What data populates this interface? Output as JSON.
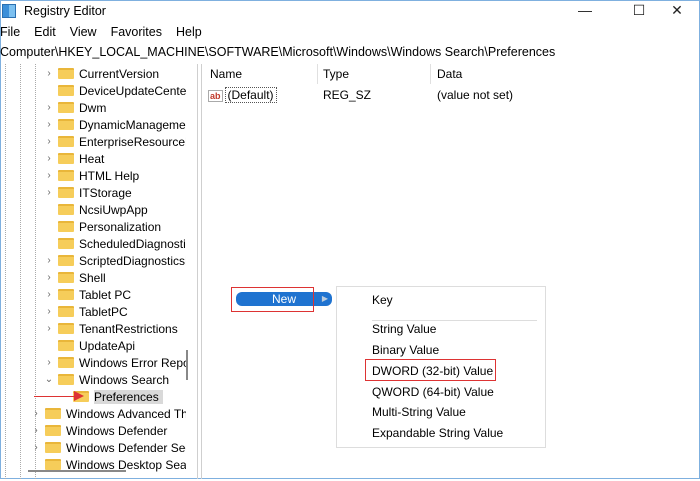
{
  "window": {
    "title": "Registry Editor",
    "minimize": "—",
    "maximize": "☐",
    "close": "✕"
  },
  "menu": [
    "File",
    "Edit",
    "View",
    "Favorites",
    "Help"
  ],
  "address": "Computer\\HKEY_LOCAL_MACHINE\\SOFTWARE\\Microsoft\\Windows\\Windows Search\\Preferences",
  "tree": [
    {
      "label": "CurrentVersion",
      "chev": ">"
    },
    {
      "label": "DeviceUpdateCenter",
      "chev": ""
    },
    {
      "label": "Dwm",
      "chev": ">"
    },
    {
      "label": "DynamicManageme",
      "chev": ">"
    },
    {
      "label": "EnterpriseResourceM",
      "chev": ">"
    },
    {
      "label": "Heat",
      "chev": ">"
    },
    {
      "label": "HTML Help",
      "chev": ">"
    },
    {
      "label": "ITStorage",
      "chev": ">"
    },
    {
      "label": "NcsiUwpApp",
      "chev": ""
    },
    {
      "label": "Personalization",
      "chev": ""
    },
    {
      "label": "ScheduledDiagnostic",
      "chev": ""
    },
    {
      "label": "ScriptedDiagnosticsP",
      "chev": ">"
    },
    {
      "label": "Shell",
      "chev": ">"
    },
    {
      "label": "Tablet PC",
      "chev": ">"
    },
    {
      "label": "TabletPC",
      "chev": ">"
    },
    {
      "label": "TenantRestrictions",
      "chev": ">"
    },
    {
      "label": "UpdateApi",
      "chev": ""
    },
    {
      "label": "Windows Error Repo",
      "chev": ">"
    },
    {
      "label": "Windows Search",
      "chev": "v"
    },
    {
      "label": "Preferences",
      "chev": "",
      "selected": true,
      "level": 3
    },
    {
      "label": "Windows Advanced Thr",
      "chev": ">",
      "level": 1
    },
    {
      "label": "Windows Defender",
      "chev": ">",
      "level": 1
    },
    {
      "label": "Windows Defender Secu",
      "chev": ">",
      "level": 1
    },
    {
      "label": "Windows Desktop Searc",
      "chev": "",
      "level": 1
    }
  ],
  "columns": {
    "name": "Name",
    "type": "Type",
    "data": "Data"
  },
  "values": [
    {
      "name": "(Default)",
      "type": "REG_SZ",
      "data": "(value not set)",
      "icon": "ab-string-icon"
    }
  ],
  "context": {
    "new_label": "New",
    "items": [
      "Key",
      "String Value",
      "Binary Value",
      "DWORD (32-bit) Value",
      "QWORD (64-bit) Value",
      "Multi-String Value",
      "Expandable String Value"
    ],
    "highlighted": "DWORD (32-bit) Value"
  },
  "colors": {
    "accent": "#1f73d0",
    "highlight_box": "#dd3333",
    "folder": "#f6cd5a"
  }
}
